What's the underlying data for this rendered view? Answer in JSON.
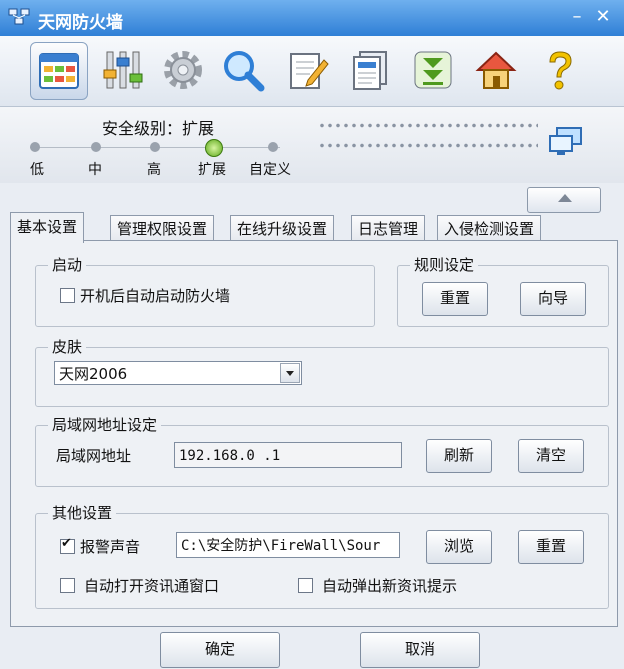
{
  "window": {
    "title": "天网防火墙"
  },
  "security": {
    "label": "安全级别：扩展",
    "levels": [
      "低",
      "中",
      "高",
      "扩展",
      "自定义"
    ],
    "selected_index": 3
  },
  "tabs": [
    "基本设置",
    "管理权限设置",
    "在线升级设置",
    "日志管理",
    "入侵检测设置"
  ],
  "startup": {
    "title": "启动",
    "autostart_label": "开机后自动启动防火墙",
    "autostart_checked": false
  },
  "rules": {
    "title": "规则设定",
    "reset_label": "重置",
    "wizard_label": "向导"
  },
  "skin": {
    "title": "皮肤",
    "selected": "天网2006"
  },
  "lan": {
    "title": "局域网地址设定",
    "label": "局域网地址",
    "value": "192.168.0  .1",
    "refresh_label": "刷新",
    "clear_label": "清空"
  },
  "other": {
    "title": "其他设置",
    "alarm_label": "报警声音",
    "alarm_checked": true,
    "alarm_path": "C:\\安全防护\\FireWall\\Sour",
    "browse_label": "浏览",
    "reset_label": "重置",
    "open_news_label": "自动打开资讯通窗口",
    "open_news_checked": false,
    "popup_news_label": "自动弹出新资讯提示",
    "popup_news_checked": false
  },
  "footer": {
    "ok_label": "确定",
    "cancel_label": "取消"
  },
  "colors": {
    "titlebar": "#3b8ae0",
    "accent_green": "#5da81b"
  }
}
